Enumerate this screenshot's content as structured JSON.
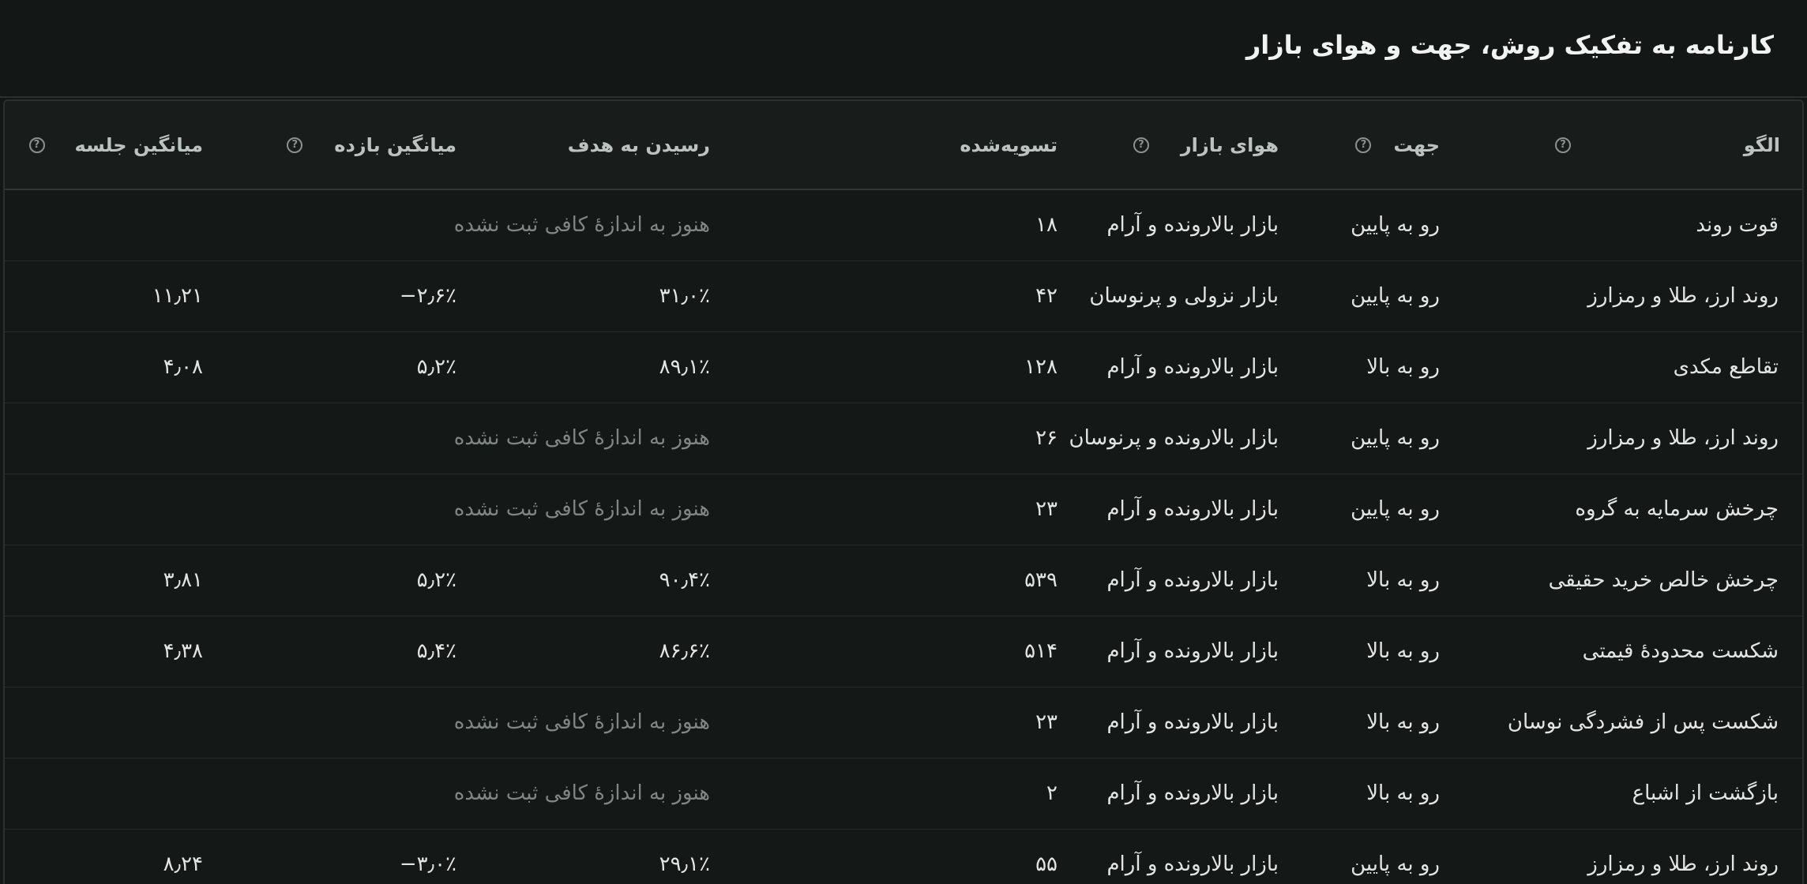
{
  "title": "کارنامه به تفکیک روش، جهت و هوای بازار",
  "columns": {
    "pattern": "الگو",
    "direction": "جهت",
    "market": "هوای بازار",
    "settled": "تسویه‌شده",
    "hit_target": "رسیدن به هدف",
    "avg_return": "میانگین بازده",
    "avg_session": "میانگین جلسه"
  },
  "help_icon": "question-circle-icon",
  "rows": [
    {
      "pattern": "قوت روند",
      "direction": "رو به پایین",
      "market": "بازار بالارونده و آرام",
      "settled": "۱۸",
      "hit_target": "هنوز به اندازهٔ کافی ثبت نشده",
      "avg_return": "",
      "avg_session": ""
    },
    {
      "pattern": "روند ارز، طلا و رمزارز",
      "direction": "رو به پایین",
      "market": "بازار نزولی و پرنوسان",
      "settled": "۴۲",
      "hit_target": "۳۱٫۰٪",
      "avg_return": "−۲٫۶٪",
      "avg_session": "۱۱٫۲۱"
    },
    {
      "pattern": "تقاطع مکدی",
      "direction": "رو به بالا",
      "market": "بازار بالارونده و آرام",
      "settled": "۱۲۸",
      "hit_target": "۸۹٫۱٪",
      "avg_return": "۵٫۲٪",
      "avg_session": "۴٫۰۸"
    },
    {
      "pattern": "روند ارز، طلا و رمزارز",
      "direction": "رو به پایین",
      "market": "بازار بالارونده و پرنوسان",
      "settled": "۲۶",
      "hit_target": "هنوز به اندازهٔ کافی ثبت نشده",
      "avg_return": "",
      "avg_session": ""
    },
    {
      "pattern": "چرخش سرمایه به گروه",
      "direction": "رو به پایین",
      "market": "بازار بالارونده و آرام",
      "settled": "۲۳",
      "hit_target": "هنوز به اندازهٔ کافی ثبت نشده",
      "avg_return": "",
      "avg_session": ""
    },
    {
      "pattern": "چرخش خالص خرید حقیقی",
      "direction": "رو به بالا",
      "market": "بازار بالارونده و آرام",
      "settled": "۵۳۹",
      "hit_target": "۹۰٫۴٪",
      "avg_return": "۵٫۲٪",
      "avg_session": "۳٫۸۱"
    },
    {
      "pattern": "شکست محدودهٔ قیمتی",
      "direction": "رو به بالا",
      "market": "بازار بالارونده و آرام",
      "settled": "۵۱۴",
      "hit_target": "۸۶٫۶٪",
      "avg_return": "۵٫۴٪",
      "avg_session": "۴٫۳۸"
    },
    {
      "pattern": "شکست پس از فشردگی نوسان",
      "direction": "رو به بالا",
      "market": "بازار بالارونده و آرام",
      "settled": "۲۳",
      "hit_target": "هنوز به اندازهٔ کافی ثبت نشده",
      "avg_return": "",
      "avg_session": ""
    },
    {
      "pattern": "بازگشت از اشباع",
      "direction": "رو به بالا",
      "market": "بازار بالارونده و آرام",
      "settled": "۲",
      "hit_target": "هنوز به اندازهٔ کافی ثبت نشده",
      "avg_return": "",
      "avg_session": ""
    },
    {
      "pattern": "روند ارز، طلا و رمزارز",
      "direction": "رو به پایین",
      "market": "بازار بالارونده و آرام",
      "settled": "۵۵",
      "hit_target": "۲۹٫۱٪",
      "avg_return": "−۳٫۰٪",
      "avg_session": "۸٫۲۴"
    }
  ]
}
